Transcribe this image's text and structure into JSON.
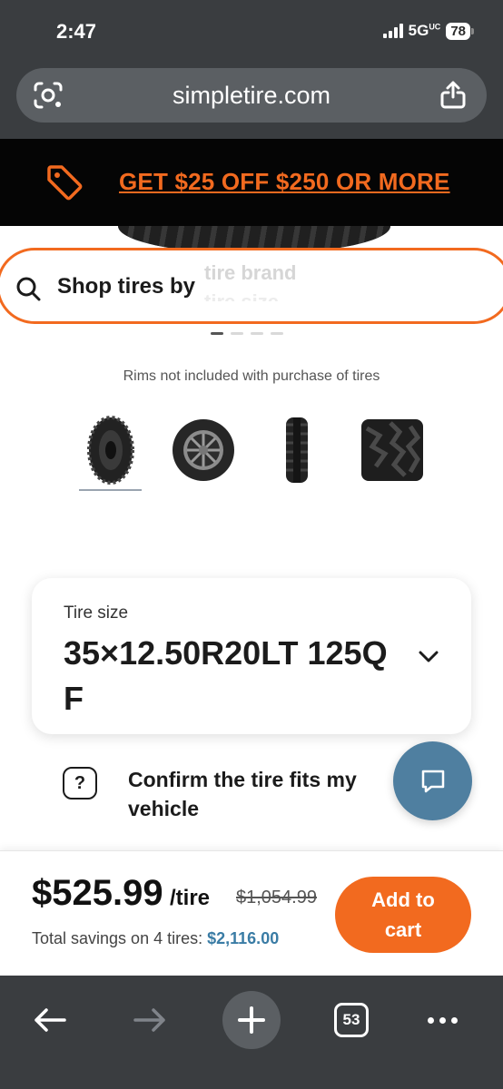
{
  "status_bar": {
    "time": "2:47",
    "network": "5G",
    "network_sup": "UC",
    "battery": "78"
  },
  "browser": {
    "url": "simpletire.com",
    "tabs_count": "53"
  },
  "promo": {
    "text": "GET $25 OFF $250 OR MORE",
    "color": "#f26a1f"
  },
  "search": {
    "label": "Shop tires by",
    "rotating_line_1": "tire brand",
    "rotating_line_2": "tire size"
  },
  "gallery": {
    "note": "Rims not included with purchase of tires",
    "dot_count": 4,
    "active_dot": 0,
    "thumbnails": [
      "tire-side-view",
      "tire-on-wheel",
      "tire-profile",
      "tread-closeup"
    ]
  },
  "size_card": {
    "label": "Tire size",
    "value": "35×12.50R20LT 125Q F"
  },
  "confirm": {
    "icon_text": "?",
    "text": "Confirm the tire fits my vehicle"
  },
  "price": {
    "current": "$525.99",
    "unit": "/tire",
    "original": "$1,054.99",
    "savings_label": "Total savings on 4 tires:",
    "savings_value": "$2,116.00"
  },
  "cta": {
    "add_to_cart": "Add to cart"
  },
  "colors": {
    "accent": "#f26a1f",
    "chat": "#4f7fa0",
    "chrome": "#3a3d40",
    "savings": "#3a7ca5"
  }
}
